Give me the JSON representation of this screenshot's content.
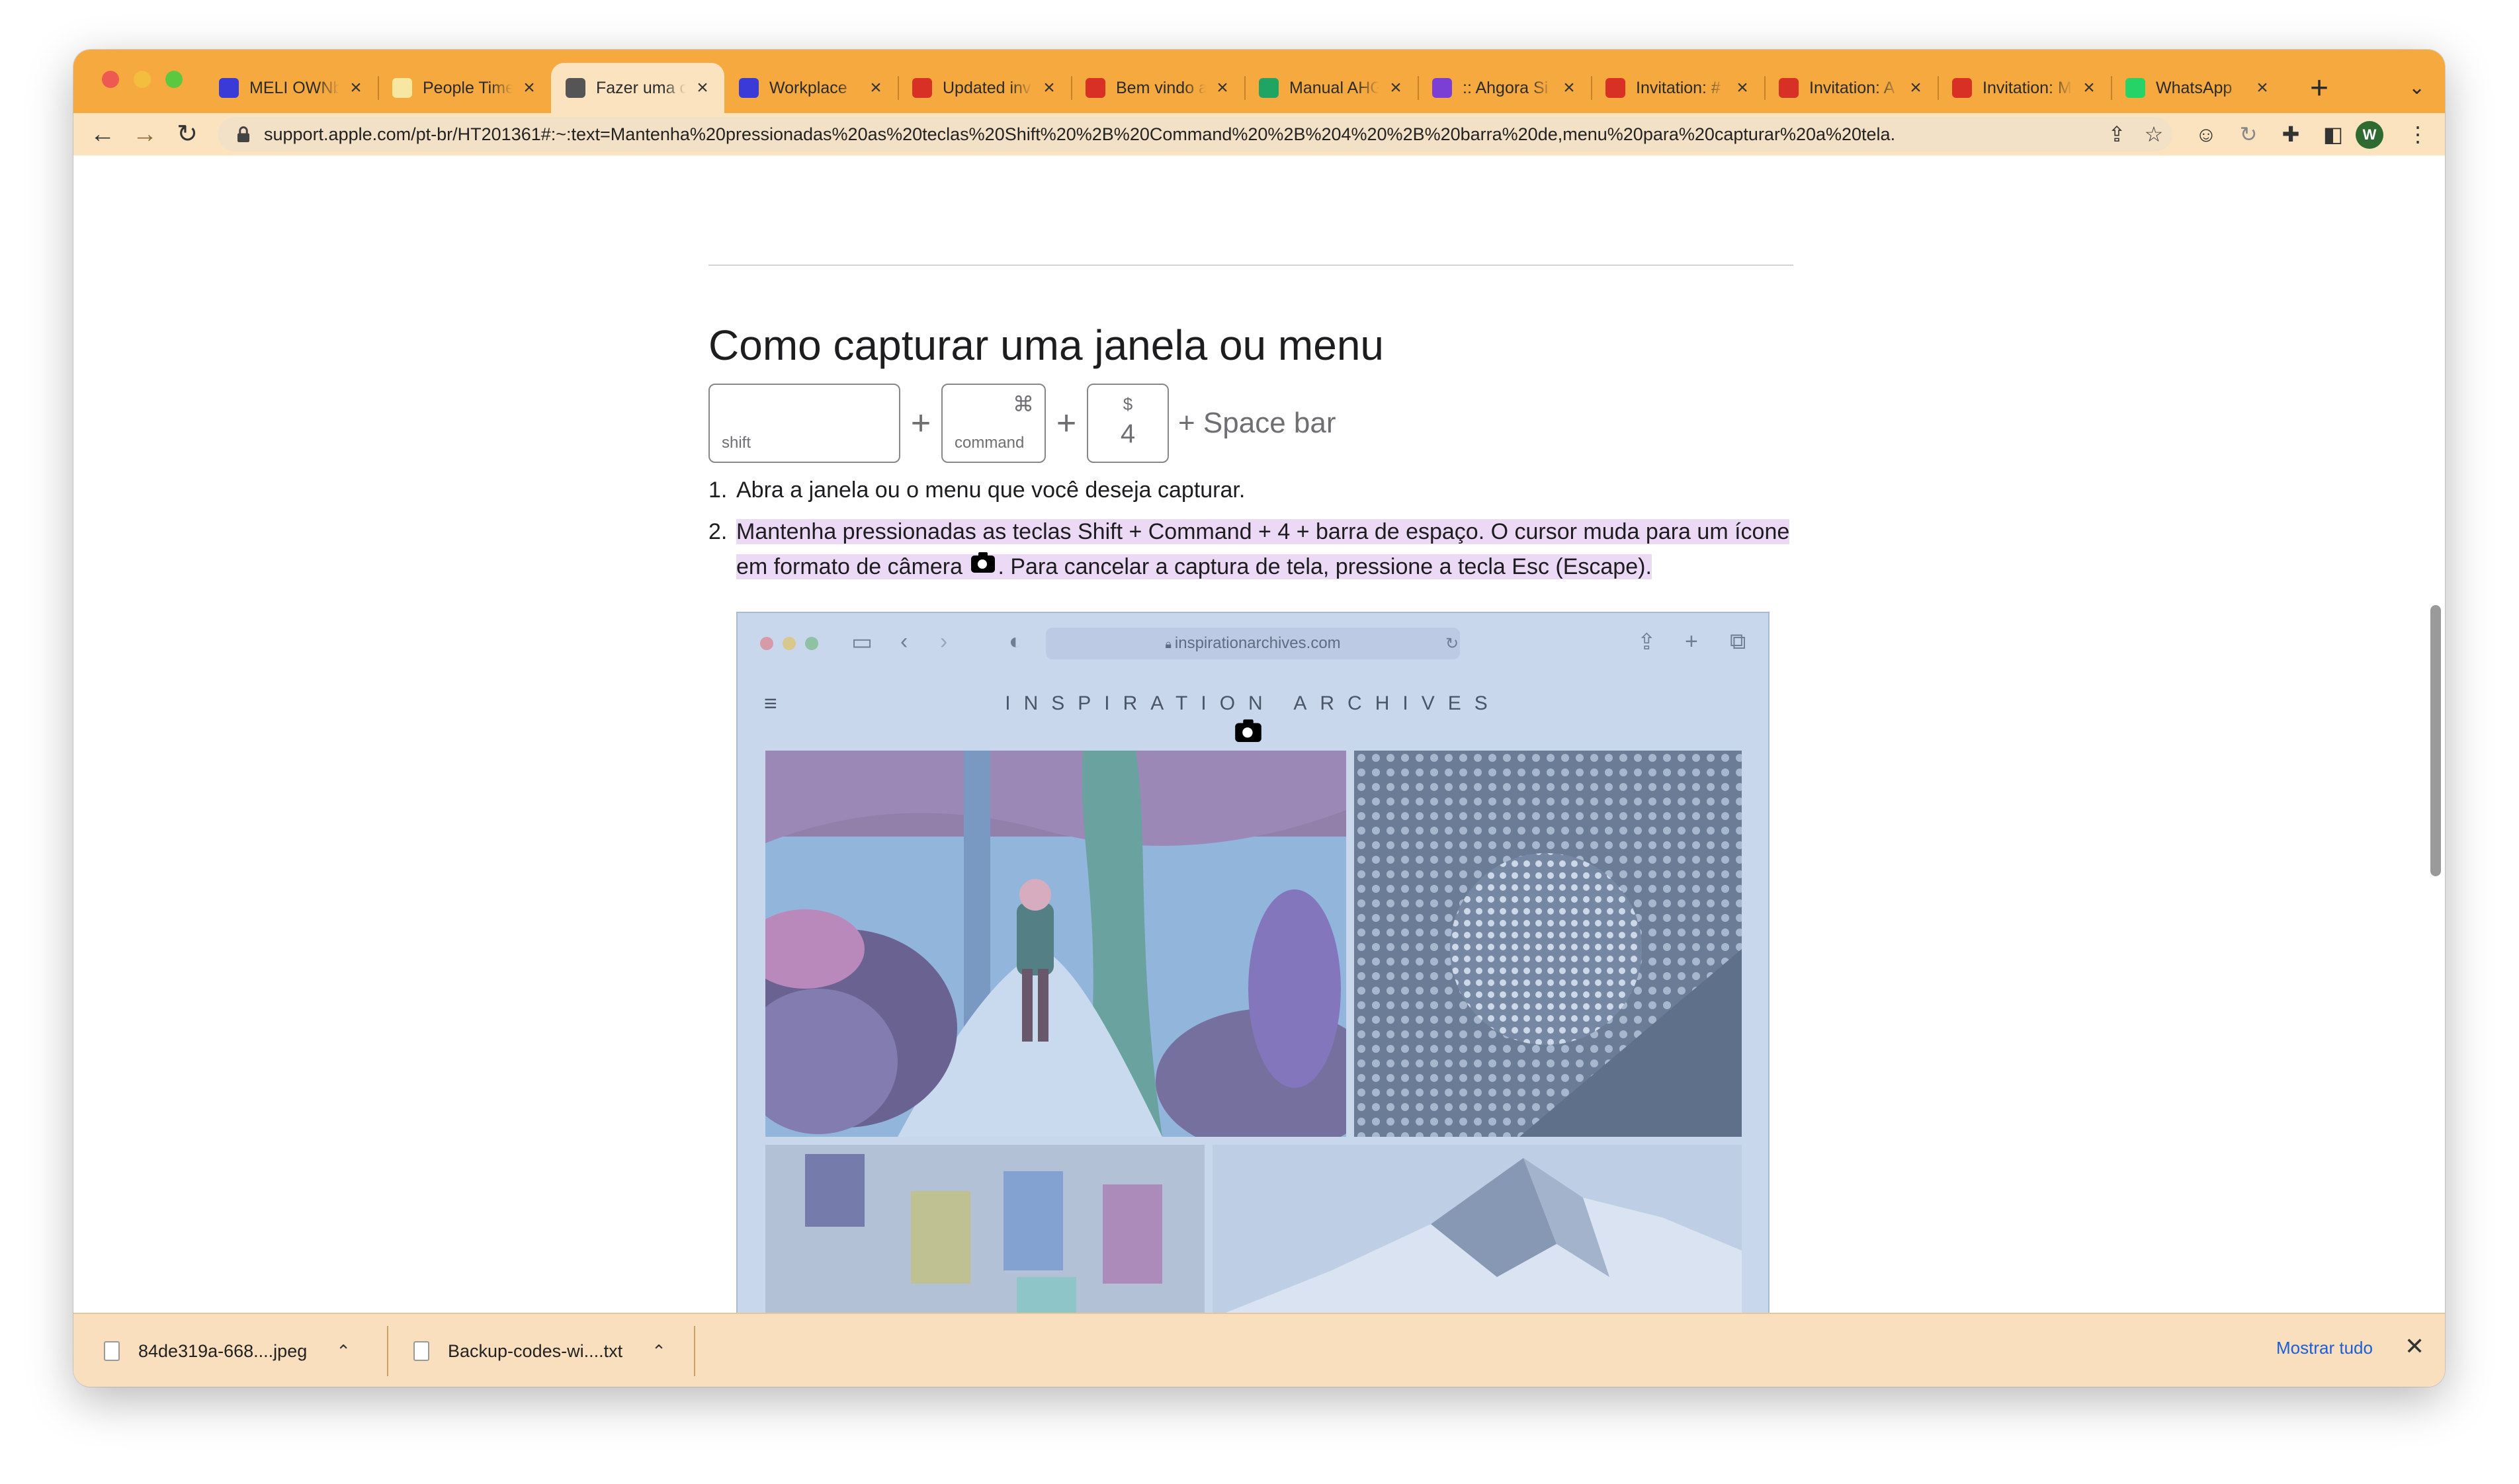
{
  "browser": {
    "tabs": [
      {
        "title": "MELI OWNb",
        "icon": "at-sign-icon",
        "color": "#3a3ad8"
      },
      {
        "title": "People Time",
        "icon": "people-time-icon",
        "color": "#f7e7a0"
      },
      {
        "title": "Fazer uma c",
        "icon": "apple-icon",
        "color": "#555555",
        "active": true
      },
      {
        "title": "Workplace",
        "icon": "at-sign-icon",
        "color": "#3a3ad8"
      },
      {
        "title": "Updated inv",
        "icon": "gmail-icon",
        "color": "#d93025"
      },
      {
        "title": "Bem vindo a",
        "icon": "gmail-icon",
        "color": "#d93025"
      },
      {
        "title": "Manual AHG",
        "icon": "google-drive-icon",
        "color": "#1fa463"
      },
      {
        "title": ":: Ahgora Si",
        "icon": "ahgora-icon",
        "color": "#7b3fd6"
      },
      {
        "title": "Invitation: #",
        "icon": "gmail-icon",
        "color": "#d93025"
      },
      {
        "title": "Invitation: A",
        "icon": "gmail-icon",
        "color": "#d93025"
      },
      {
        "title": "Invitation: M",
        "icon": "gmail-icon",
        "color": "#d93025"
      },
      {
        "title": "WhatsApp",
        "icon": "whatsapp-icon",
        "color": "#25d366"
      }
    ],
    "url": "support.apple.com/pt-br/HT201361#:~:text=Mantenha%20pressionadas%20as%20teclas%20Shift%20%2B%20Command%20%2B%204%20%2B%20barra%20de,menu%20para%20capturar%20a%20tela.",
    "avatar_letter": "W"
  },
  "article": {
    "heading": "Como capturar uma janela ou menu",
    "keys": {
      "shift": "shift",
      "command_symbol": "⌘",
      "command": "command",
      "four_symbol": "$",
      "four": "4",
      "plus": "+",
      "space_bar": "+ Space bar"
    },
    "steps": [
      {
        "num": "1.",
        "text": "Abra a janela ou o menu que você deseja capturar."
      },
      {
        "num": "2.",
        "text_before": "Mantenha pressionadas as teclas Shift + Command + 4 + barra de espaço. O cursor muda para um ícone em formato de câmera ",
        "text_after": ". Para cancelar a captura de tela, pressione a tecla Esc (Escape)."
      }
    ],
    "screenshot": {
      "url": "inspirationarchives.com",
      "brand": "INSPIRATION ARCHIVES"
    }
  },
  "downloads": {
    "items": [
      {
        "name": "84de319a-668....jpeg"
      },
      {
        "name": "Backup-codes-wi....txt"
      }
    ],
    "show_all": "Mostrar tudo"
  }
}
